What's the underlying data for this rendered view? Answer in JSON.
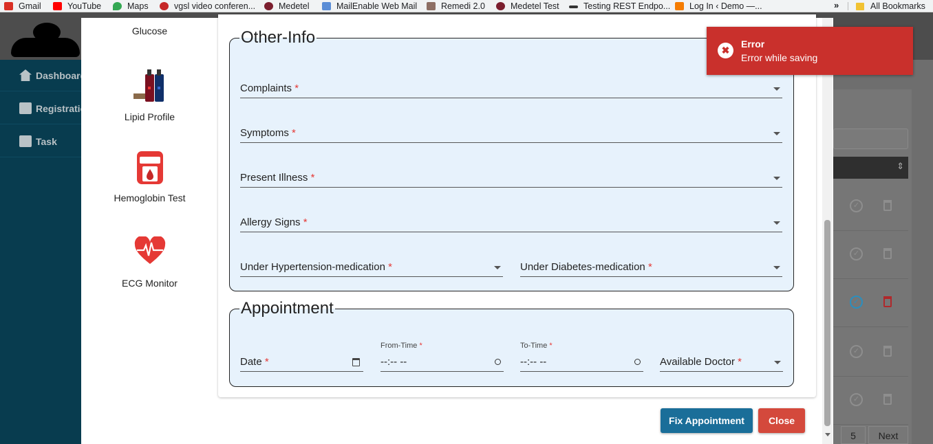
{
  "bookmarks": {
    "items": [
      {
        "label": "Gmail",
        "color": "#d93025"
      },
      {
        "label": "YouTube",
        "color": "#ff0000"
      },
      {
        "label": "Maps",
        "color": "#34a853"
      },
      {
        "label": "vgsl video conferen...",
        "color": "#c62828"
      },
      {
        "label": "Medetel",
        "color": "#7b1e2e"
      },
      {
        "label": "MailEnable Web Mail",
        "color": "#5a8dd6"
      },
      {
        "label": "Remedi 2.0",
        "color": "#8d6e63"
      },
      {
        "label": "Medetel Test",
        "color": "#7b1e2e"
      },
      {
        "label": "Testing REST Endpo...",
        "color": "#333333"
      },
      {
        "label": "Log In ‹ Demo —...",
        "color": "#f57c00"
      }
    ],
    "more": "»",
    "all_label": "All Bookmarks"
  },
  "sidebar": {
    "items": [
      {
        "label": "Dashboard",
        "icon": "home-icon"
      },
      {
        "label": "Registration",
        "icon": "book-icon"
      },
      {
        "label": "Task",
        "icon": "book-icon"
      }
    ]
  },
  "tests": [
    {
      "label": "Glucose",
      "icon": "glucose-icon"
    },
    {
      "label": "Lipid Profile",
      "icon": "lipid-device-icon"
    },
    {
      "label": "Hemoglobin Test",
      "icon": "hemoglobin-device-icon"
    },
    {
      "label": "ECG Monitor",
      "icon": "heart-ecg-icon"
    }
  ],
  "other_info": {
    "legend": "Other-Info",
    "complaints": "Complaints",
    "symptoms": "Symptoms",
    "present_illness": "Present Illness",
    "allergy_signs": "Allergy Signs",
    "hypertension": "Under Hypertension-medication",
    "diabetes": "Under Diabetes-medication",
    "required_mark": "*"
  },
  "appointment": {
    "legend": "Appointment",
    "date_label": "Date",
    "from_label": "From-Time",
    "from_value": "--:-- --",
    "to_label": "To-Time",
    "to_value": "--:-- --",
    "doctor_label": "Available Doctor"
  },
  "buttons": {
    "fix": "Fix Appointment",
    "close": "Close"
  },
  "toast": {
    "title": "Error",
    "message": "Error while saving",
    "icon": "✖"
  },
  "background": {
    "pagination_current": "5",
    "pagination_next": "Next",
    "sort_icon": "⇕"
  },
  "colors": {
    "primary": "#1a6e99",
    "danger": "#d4493c",
    "toast": "#c9302c",
    "section_bg": "#e7f2fc",
    "sidebar": "#083c4f"
  }
}
